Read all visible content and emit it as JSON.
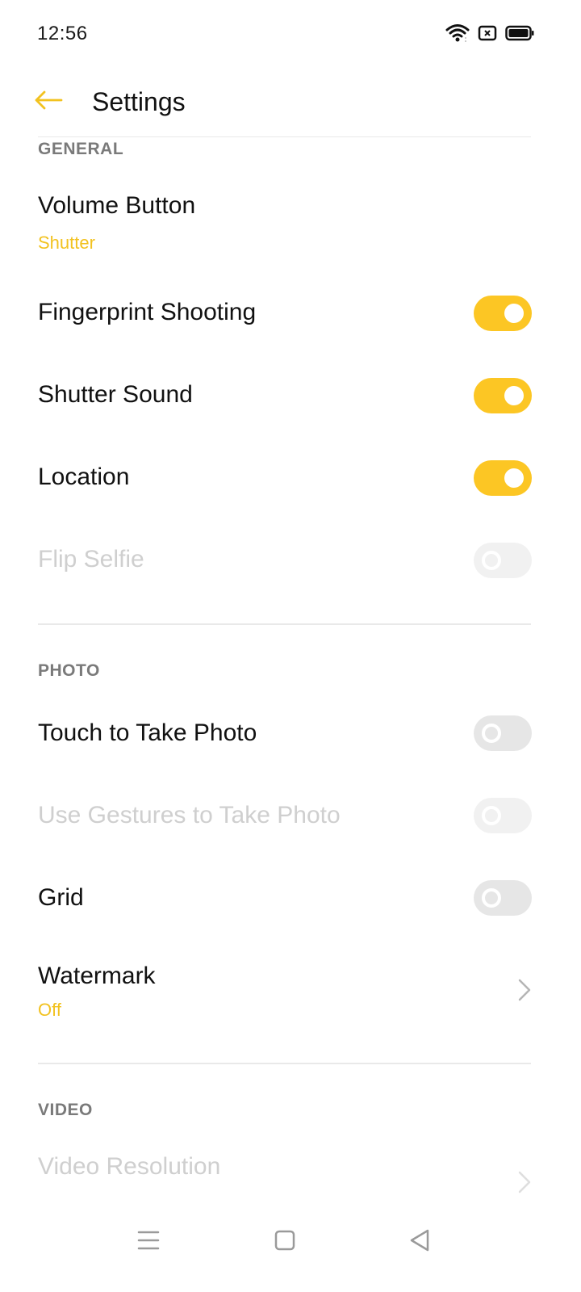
{
  "status_bar": {
    "time": "12:56",
    "icons": [
      "wifi-icon",
      "sim-card-icon",
      "battery-icon"
    ]
  },
  "app_bar": {
    "back_icon": "arrow-left-icon",
    "title": "Settings"
  },
  "colors": {
    "accent": "#fcc624",
    "subtitle": "#f2c220",
    "section_header": "#7a7a7a",
    "disabled_text": "#cfcfcf",
    "switch_off": "#e6e6e6"
  },
  "general": {
    "header": "GENERAL",
    "volume_button": {
      "title": "Volume Button",
      "value": "Shutter"
    },
    "fingerprint_shooting": {
      "title": "Fingerprint Shooting",
      "on": true
    },
    "shutter_sound": {
      "title": "Shutter Sound",
      "on": true
    },
    "location": {
      "title": "Location",
      "on": true
    },
    "flip_selfie": {
      "title": "Flip Selfie",
      "on": false,
      "disabled": true
    }
  },
  "photo": {
    "header": "PHOTO",
    "touch_to_take_photo": {
      "title": "Touch to Take Photo",
      "on": false
    },
    "use_gestures": {
      "title": "Use Gestures to Take Photo",
      "on": false,
      "disabled": true
    },
    "grid": {
      "title": "Grid",
      "on": false
    },
    "watermark": {
      "title": "Watermark",
      "value": "Off"
    }
  },
  "video": {
    "header": "VIDEO",
    "video_resolution": {
      "title": "Video Resolution"
    }
  },
  "nav_bar": {
    "icons": [
      "menu-icon",
      "home-icon",
      "back-triangle-icon"
    ]
  }
}
